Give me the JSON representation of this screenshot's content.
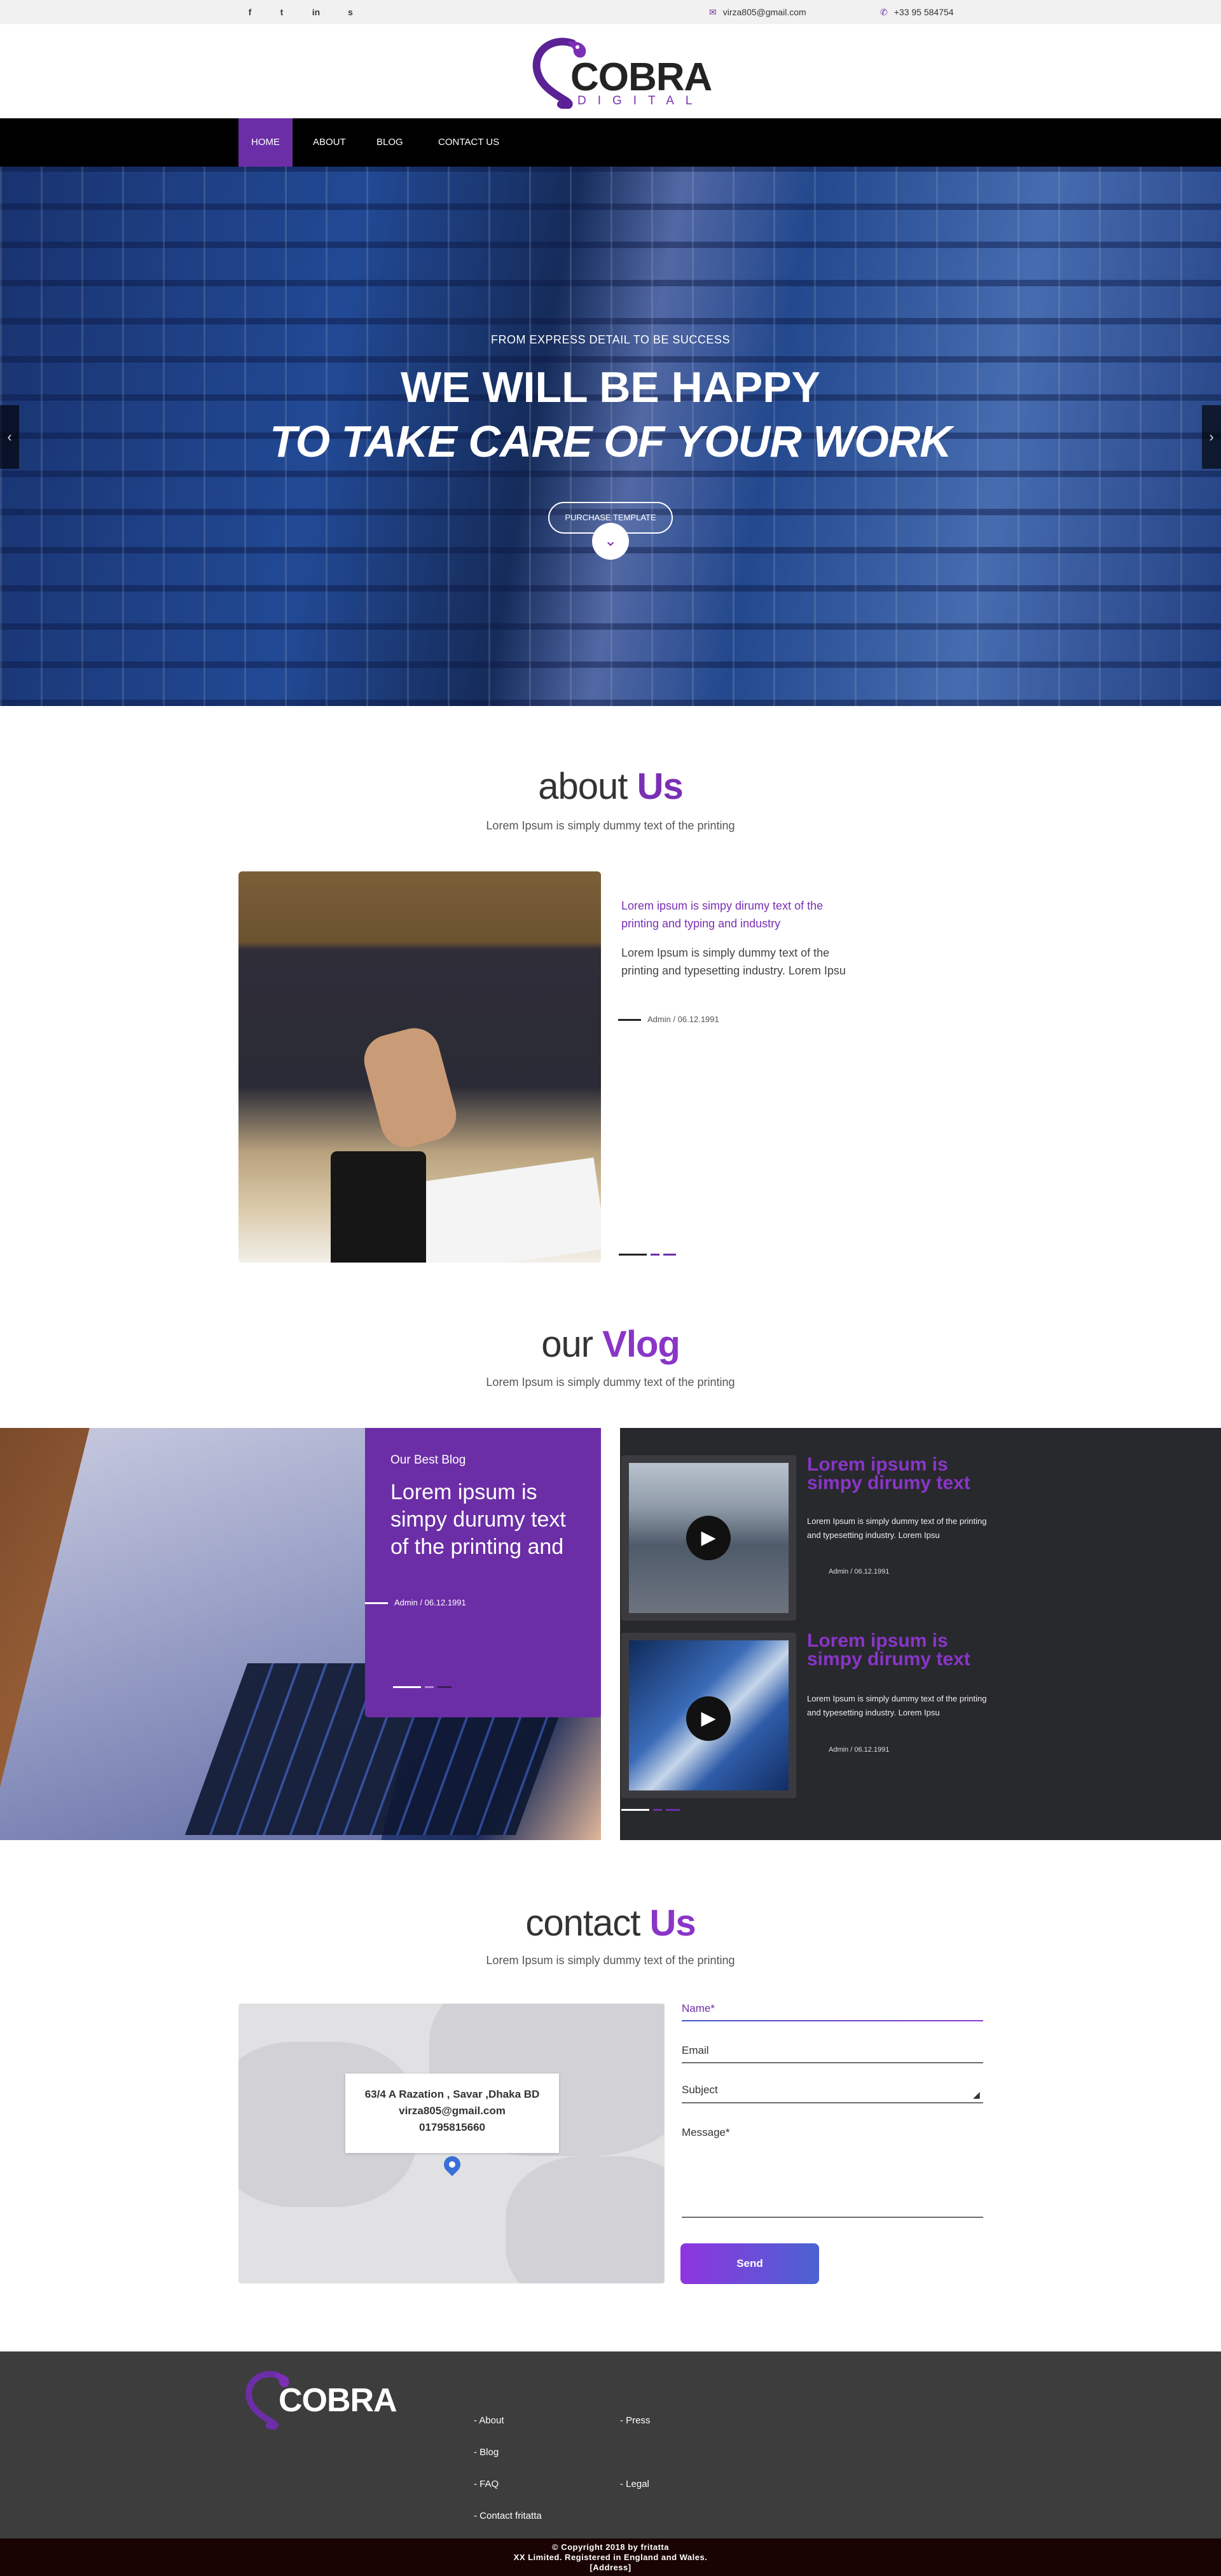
{
  "topbar": {
    "social": [
      {
        "name": "facebook-icon",
        "glyph": "f"
      },
      {
        "name": "twitter-icon",
        "glyph": "t"
      },
      {
        "name": "linkedin-icon",
        "glyph": "in"
      },
      {
        "name": "skype-icon",
        "glyph": "s"
      }
    ],
    "email": "virza805@gmail.com",
    "phone": "+33 95 584754"
  },
  "brand": {
    "name": "COBRA",
    "sub": "DIGITAL",
    "accent_color": "#6c2ea6"
  },
  "nav": {
    "items": [
      {
        "label": "HOME",
        "active": true
      },
      {
        "label": "ABOUT",
        "active": false
      },
      {
        "label": "BLOG",
        "active": false
      },
      {
        "label": "CONTACT US",
        "active": false
      }
    ]
  },
  "hero": {
    "kicker": "FROM EXPRESS DETAIL TO BE SUCCESS",
    "line1": "WE WILL BE HAPPY",
    "line2": "TO TAKE CARE OF YOUR WORK",
    "button": "PURCHASE TEMPLATE",
    "prev_icon": "chevron-left-icon",
    "next_icon": "chevron-right-icon",
    "down_icon": "chevron-down-icon"
  },
  "about": {
    "title_plain": "about",
    "title_accent": "Us",
    "subtitle": "Lorem Ipsum is simply dummy text of the printing",
    "lead": "Lorem ipsum is simpy dirumy text of the printing and typing and industry",
    "body": "Lorem Ipsum is simply dummy text of the printing and typesetting industry. Lorem Ipsu",
    "meta": "Admin / 06.12.1991"
  },
  "vlog": {
    "title_plain": "our",
    "title_accent": "Vlog",
    "subtitle": "Lorem Ipsum is simply dummy text of the printing",
    "card": {
      "kicker": "Our Best Blog",
      "title": "Lorem ipsum is simpy durumy text of the printing and",
      "meta": "Admin / 06.12.1991"
    },
    "videos": [
      {
        "title": "Lorem ipsum is simpy dirumy text",
        "body": "Lorem Ipsum is simply dummy text of the printing and typesetting industry. Lorem Ipsu",
        "meta": "Admin / 06.12.1991"
      },
      {
        "title": "Lorem ipsum is simpy dirumy text",
        "body": "Lorem Ipsum is simply dummy text of the printing and typesetting industry. Lorem Ipsu",
        "meta": "Admin / 06.12.1991"
      }
    ]
  },
  "contact": {
    "title_plain": "contact",
    "title_accent": "Us",
    "subtitle": "Lorem Ipsum is simply dummy text of the printing",
    "map": {
      "address": "63/4 A Razation , Savar ,Dhaka BD",
      "email": "virza805@gmail.com",
      "phone": "01795815660"
    },
    "form": {
      "name": "Name*",
      "email": "Email",
      "subject": "Subject",
      "message": "Message*",
      "send": "Send"
    }
  },
  "footer": {
    "links_col1": [
      "- About",
      "- Blog",
      "- FAQ",
      "- Contact fritatta"
    ],
    "links_col2": [
      "- Press",
      "- Legal"
    ],
    "copyright1": "© Copyright 2018 by fritatta",
    "copyright2": "XX Limited. Registered in England and Wales.",
    "copyright3": "[Address]"
  }
}
